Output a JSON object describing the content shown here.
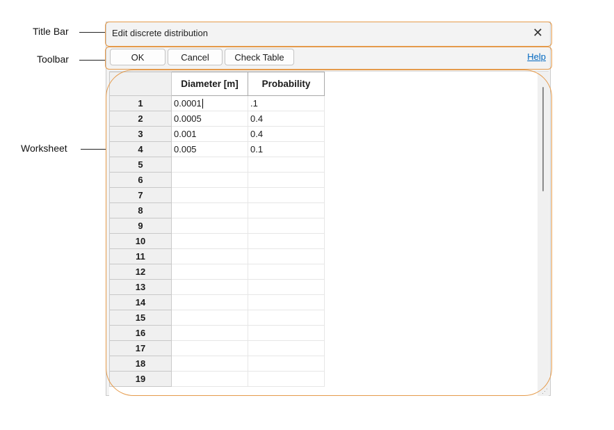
{
  "callouts": {
    "title_bar": "Title Bar",
    "toolbar": "Toolbar",
    "worksheet": "Worksheet"
  },
  "window": {
    "title": "Edit discrete distribution",
    "close_glyph": "✕"
  },
  "toolbar": {
    "ok_label": "OK",
    "cancel_label": "Cancel",
    "check_table_label": "Check Table",
    "help_label": "Help"
  },
  "table": {
    "columns": [
      "Diameter [m]",
      "Probability"
    ],
    "rows": [
      {
        "n": "1",
        "diameter": "0.0001",
        "probability": ".1"
      },
      {
        "n": "2",
        "diameter": "0.0005",
        "probability": "0.4"
      },
      {
        "n": "3",
        "diameter": "0.001",
        "probability": "0.4"
      },
      {
        "n": "4",
        "diameter": "0.005",
        "probability": "0.1"
      },
      {
        "n": "5",
        "diameter": "",
        "probability": ""
      },
      {
        "n": "6",
        "diameter": "",
        "probability": ""
      },
      {
        "n": "7",
        "diameter": "",
        "probability": ""
      },
      {
        "n": "8",
        "diameter": "",
        "probability": ""
      },
      {
        "n": "9",
        "diameter": "",
        "probability": ""
      },
      {
        "n": "10",
        "diameter": "",
        "probability": ""
      },
      {
        "n": "11",
        "diameter": "",
        "probability": ""
      },
      {
        "n": "12",
        "diameter": "",
        "probability": ""
      },
      {
        "n": "13",
        "diameter": "",
        "probability": ""
      },
      {
        "n": "14",
        "diameter": "",
        "probability": ""
      },
      {
        "n": "15",
        "diameter": "",
        "probability": ""
      },
      {
        "n": "16",
        "diameter": "",
        "probability": ""
      },
      {
        "n": "17",
        "diameter": "",
        "probability": ""
      },
      {
        "n": "18",
        "diameter": "",
        "probability": ""
      },
      {
        "n": "19",
        "diameter": "",
        "probability": ""
      }
    ]
  },
  "colors": {
    "highlight": "#e59a4a",
    "link": "#0067c0"
  }
}
